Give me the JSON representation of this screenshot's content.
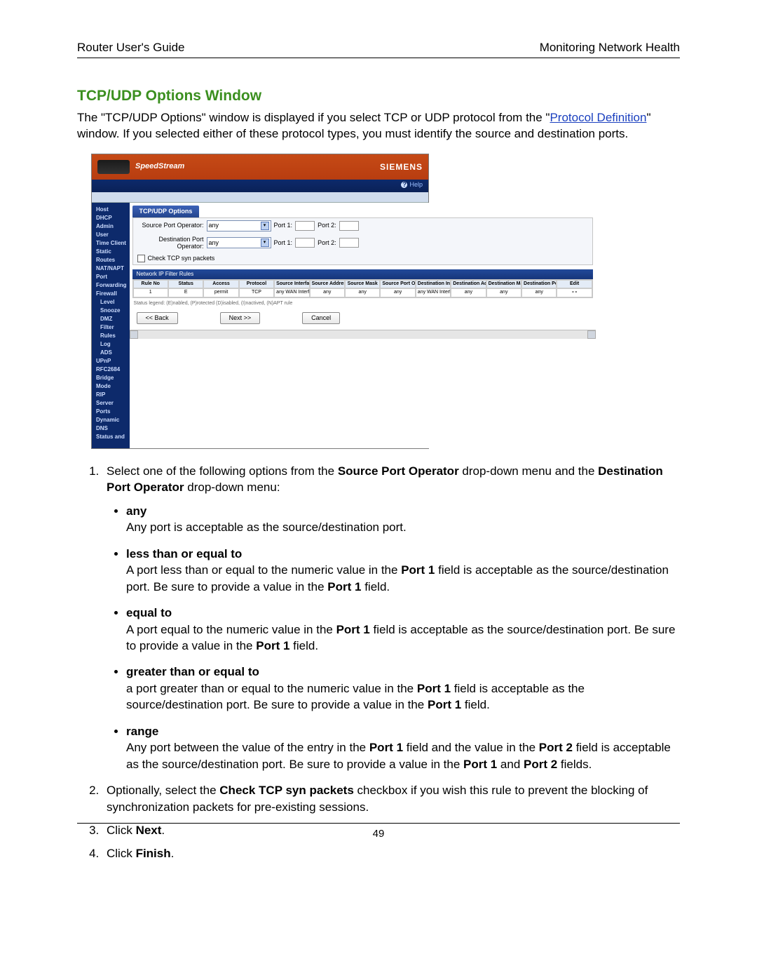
{
  "header": {
    "left": "Router User's Guide",
    "right": "Monitoring Network Health"
  },
  "title": "TCP/UDP Options Window",
  "intro": {
    "part1": "The \"TCP/UDP Options\" window is displayed if you select TCP or UDP protocol from the \"",
    "link1": "Protocol Definition",
    "part2": "\" window. If you selected either of these protocol types, you must identify the source and destination ports."
  },
  "screenshot": {
    "brand": "SpeedStream",
    "logo": "SIEMENS",
    "help": "Help",
    "side": [
      "Host",
      "DHCP",
      "Admin User",
      "Time Client",
      "Static Routes",
      "NAT/NAPT",
      "Port Forwarding",
      "Firewall",
      "Level",
      "Snooze",
      "DMZ",
      "Filter Rules",
      "Log",
      "ADS",
      "UPnP",
      "RFC2684",
      "Bridge Mode",
      "RIP",
      "Server Ports",
      "Dynamic DNS",
      "Status and"
    ],
    "side_indent": [
      8,
      9,
      10,
      11,
      12,
      13
    ],
    "tab": "TCP/UDP Options",
    "labels": {
      "src": "Source Port Operator:",
      "dst": "Destination Port Operator:",
      "any": "any",
      "p1": "Port 1:",
      "p2": "Port 2:",
      "chk": "Check TCP syn packets"
    },
    "banner": "Network IP Filter Rules",
    "thead": [
      "Rule No",
      "Status",
      "Access",
      "Protocol",
      "Source Interface",
      "Source Address",
      "Source Mask",
      "Source Port Op",
      "Destination Interface",
      "Destination Address",
      "Destination Mask",
      "Destination Port Op",
      "Edit"
    ],
    "trow": [
      "1",
      "E",
      "permit",
      "TCP",
      "any WAN Interface",
      "any",
      "any",
      "any",
      "any WAN Interface",
      "any",
      "any",
      "any",
      "∘∘"
    ],
    "legend": "Status legend: (E)nabled, (P)rotected (D)isabled, (I)nactived, (N)APT rule",
    "btn_back": "<< Back",
    "btn_next": "Next >>",
    "btn_cancel": "Cancel"
  },
  "steps": {
    "s1a": "Select one of the following options from the ",
    "s1b": "Source Port Operator",
    "s1c": " drop-down menu and the ",
    "s1d": "Destination Port Operator",
    "s1e": " drop-down menu:",
    "options": [
      {
        "name": "any",
        "desc": [
          {
            "t": "Any port is acceptable as the source/destination port."
          }
        ]
      },
      {
        "name": "less than or equal to",
        "desc": [
          {
            "t": "A port less than or equal to the numeric value in the "
          },
          {
            "b": "Port 1"
          },
          {
            "t": " field is acceptable as the source/destination port. Be sure to provide a value in the "
          },
          {
            "b": "Port 1"
          },
          {
            "t": " field."
          }
        ]
      },
      {
        "name": "equal to",
        "desc": [
          {
            "t": "A port equal to the numeric value in the "
          },
          {
            "b": "Port 1"
          },
          {
            "t": " field is acceptable as the source/destination port. Be sure to provide a value in the "
          },
          {
            "b": "Port 1"
          },
          {
            "t": " field."
          }
        ]
      },
      {
        "name": "greater than or equal to",
        "desc": [
          {
            "t": "a port greater than or equal to the numeric value in the "
          },
          {
            "b": "Port 1"
          },
          {
            "t": " field is acceptable as the source/destination port. Be sure to provide a value in the "
          },
          {
            "b": "Port 1"
          },
          {
            "t": " field."
          }
        ]
      },
      {
        "name": "range",
        "desc": [
          {
            "t": "Any port between the value of the entry in the "
          },
          {
            "b": "Port 1"
          },
          {
            "t": " field and the value in the "
          },
          {
            "b": "Port 2"
          },
          {
            "t": " field is acceptable as the source/destination port. Be sure to provide a value in the "
          },
          {
            "b": "Port 1"
          },
          {
            "t": " and "
          },
          {
            "b": "Port 2"
          },
          {
            "t": " fields."
          }
        ]
      }
    ],
    "s2a": "Optionally, select the ",
    "s2b": "Check TCP syn packets",
    "s2c": " checkbox if you wish this rule to prevent the blocking of synchronization packets for pre-existing sessions.",
    "s3a": "Click ",
    "s3b": "Next",
    "s3c": ".",
    "s4a": "Click ",
    "s4b": "Finish",
    "s4c": "."
  },
  "page_number": "49"
}
